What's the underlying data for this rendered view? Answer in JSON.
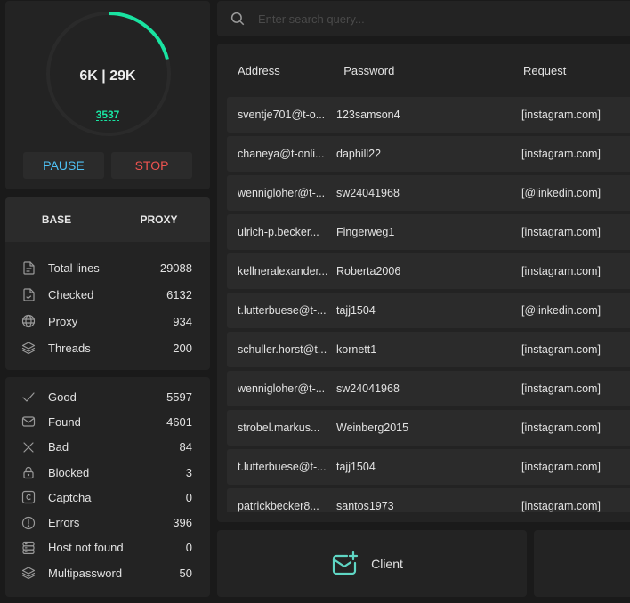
{
  "progress": {
    "checked_short": "6K",
    "total_short": "29K",
    "separator": " | ",
    "main_text": "6K | 29K",
    "sub_value": "3537",
    "fraction": 0.211,
    "accent_color": "#19e3a1",
    "pause_label": "PAUSE",
    "stop_label": "STOP"
  },
  "info": {
    "tabs": [
      {
        "label": "BASE"
      },
      {
        "label": "PROXY"
      }
    ],
    "stats": [
      {
        "icon": "file-lines-icon",
        "label": "Total lines",
        "value": "29088"
      },
      {
        "icon": "file-check-icon",
        "label": "Checked",
        "value": "6132"
      },
      {
        "icon": "globe-icon",
        "label": "Proxy",
        "value": "934"
      },
      {
        "icon": "layers-icon",
        "label": "Threads",
        "value": "200"
      }
    ]
  },
  "results": [
    {
      "icon": "check-icon",
      "label": "Good",
      "value": "5597"
    },
    {
      "icon": "mail-icon",
      "label": "Found",
      "value": "4601"
    },
    {
      "icon": "x-icon",
      "label": "Bad",
      "value": "84"
    },
    {
      "icon": "lock-icon",
      "label": "Blocked",
      "value": "3"
    },
    {
      "icon": "captcha-icon",
      "label": "Captcha",
      "value": "0"
    },
    {
      "icon": "alert-circle-icon",
      "label": "Errors",
      "value": "396"
    },
    {
      "icon": "server-icon",
      "label": "Host not found",
      "value": "0"
    },
    {
      "icon": "layers-icon",
      "label": "Multipassword",
      "value": "50"
    }
  ],
  "search": {
    "placeholder": "Enter search query..."
  },
  "table": {
    "columns": [
      "Address",
      "Password",
      "Request"
    ],
    "rows": [
      {
        "address": "sventje701@t-o...",
        "password": "123samson4",
        "request": "[instagram.com]"
      },
      {
        "address": "chaneya@t-onli...",
        "password": "daphill22",
        "request": "[instagram.com]"
      },
      {
        "address": "wennigloher@t-...",
        "password": "sw24041968",
        "request": "[@linkedin.com]"
      },
      {
        "address": "ulrich-p.becker...",
        "password": "Fingerweg1",
        "request": "[instagram.com]"
      },
      {
        "address": "kellneralexander...",
        "password": "Roberta2006",
        "request": "[instagram.com]"
      },
      {
        "address": "t.lutterbuese@t-...",
        "password": "tajj1504",
        "request": "[@linkedin.com]"
      },
      {
        "address": "schuller.horst@t...",
        "password": "kornett1",
        "request": "[instagram.com]"
      },
      {
        "address": "wennigloher@t-...",
        "password": "sw24041968",
        "request": "[instagram.com]"
      },
      {
        "address": "strobel.markus...",
        "password": "Weinberg2015",
        "request": "[instagram.com]"
      },
      {
        "address": "t.lutterbuese@t-...",
        "password": "tajj1504",
        "request": "[instagram.com]"
      },
      {
        "address": "patrickbecker8...",
        "password": "santos1973",
        "request": "[instagram.com]"
      }
    ]
  },
  "bottom": {
    "client_label": "Client",
    "client_icon": "mail-plus-icon",
    "icon_color": "#5fd6c4"
  }
}
